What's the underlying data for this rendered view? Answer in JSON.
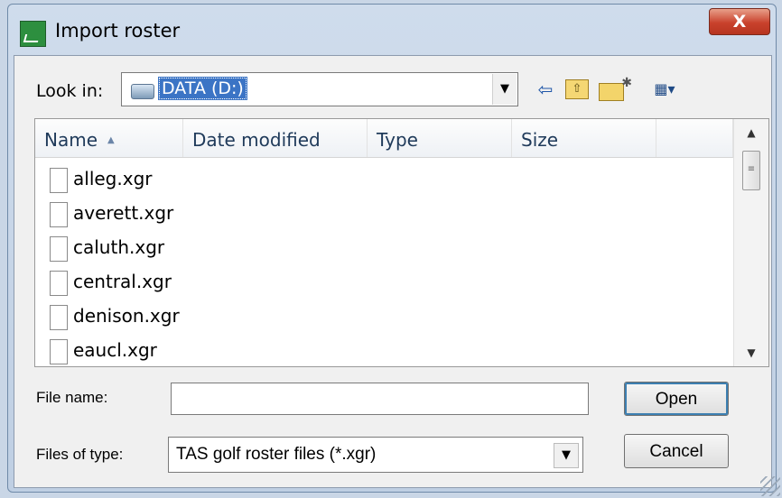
{
  "window": {
    "title": "Import roster",
    "close_label": "X"
  },
  "toolbar": {
    "look_in_label": "Look in:",
    "look_in_value": "DATA (D:)",
    "icons": [
      "back-icon",
      "up-folder-icon",
      "new-folder-icon",
      "view-menu-icon"
    ]
  },
  "list": {
    "columns": [
      "Name",
      "Date modified",
      "Type",
      "Size"
    ],
    "files": [
      "alleg.xgr",
      "averett.xgr",
      "caluth.xgr",
      "central.xgr",
      "denison.xgr",
      "eaucl.xgr"
    ]
  },
  "footer": {
    "file_name_label": "File name:",
    "file_name_value": "",
    "file_type_label": "Files of type:",
    "file_type_value": "TAS golf roster files (*.xgr)",
    "open_label": "Open",
    "cancel_label": "Cancel"
  }
}
